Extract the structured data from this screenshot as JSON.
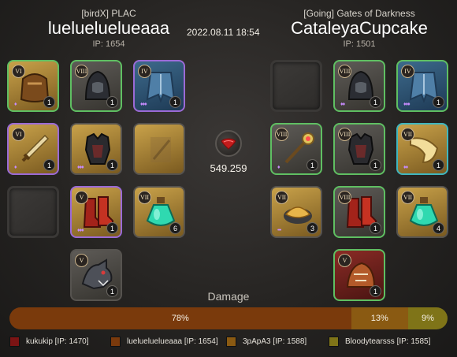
{
  "killer": {
    "guild": "[birdX] PLAC",
    "name": "luelueluelueaaa",
    "ip": "IP: 1654"
  },
  "victim": {
    "guild": "[Going] Gates of Darkness",
    "name": "CataleyaCupcake",
    "ip": "IP: 1501"
  },
  "timestamp": "2022.08.11 18:54",
  "kill_fame": "549.259",
  "colors": {
    "gold": "#c9a24a",
    "red": "#8a2b25",
    "green": "#5fbf62",
    "purple": "#9b6ad6",
    "teal": "#3fb6bf"
  },
  "killer_slots": [
    {
      "key": "bag",
      "icon": "bag-icon",
      "tier": "VI",
      "qty": "1",
      "frame": "green",
      "bg": "gold",
      "enchant": "♦"
    },
    {
      "key": "head",
      "icon": "hood-helmet-icon",
      "tier": "VIII",
      "qty": "1",
      "frame": "green",
      "bg": "gray",
      "enchant": ""
    },
    {
      "key": "cape",
      "icon": "cape-icon",
      "tier": "IV",
      "qty": "1",
      "frame": "purple",
      "bg": "blue",
      "enchant": "♦♦♦"
    },
    {
      "key": "mainhand",
      "icon": "sword-icon",
      "tier": "VI",
      "qty": "1",
      "frame": "purple",
      "bg": "gold",
      "enchant": "♦"
    },
    {
      "key": "armor",
      "icon": "armor-icon",
      "tier": "",
      "qty": "1",
      "frame": "gray",
      "bg": "gold",
      "enchant": "♦♦♦"
    },
    {
      "key": "offhand",
      "icon": "ghost-offhand-icon",
      "tier": "",
      "qty": "",
      "frame": "gray",
      "bg": "gold",
      "enchant": ""
    },
    {
      "key": "food",
      "icon": "",
      "tier": "",
      "qty": "",
      "frame": "empty",
      "bg": "",
      "enchant": ""
    },
    {
      "key": "shoes",
      "icon": "boots-icon",
      "tier": "V",
      "qty": "1",
      "frame": "purple",
      "bg": "gold",
      "enchant": "♦♦♦"
    },
    {
      "key": "potion",
      "icon": "potion-icon",
      "tier": "VII",
      "qty": "6",
      "frame": "gray",
      "bg": "gold",
      "enchant": ""
    },
    {
      "key": "mount",
      "icon": "wolf-mount-icon",
      "tier": "V",
      "qty": "1",
      "frame": "gray",
      "bg": "gray",
      "enchant": ""
    }
  ],
  "victim_slots": [
    {
      "key": "bag",
      "icon": "",
      "tier": "",
      "qty": "",
      "frame": "empty",
      "bg": "",
      "enchant": ""
    },
    {
      "key": "head",
      "icon": "hood-helmet-icon",
      "tier": "VIII",
      "qty": "1",
      "frame": "green",
      "bg": "gray",
      "enchant": "♦♦"
    },
    {
      "key": "cape",
      "icon": "cape-icon",
      "tier": "IV",
      "qty": "1",
      "frame": "green",
      "bg": "blue",
      "enchant": "♦♦♦"
    },
    {
      "key": "mainhand",
      "icon": "staff-icon",
      "tier": "VIII",
      "qty": "1",
      "frame": "green",
      "bg": "gray",
      "enchant": "♦"
    },
    {
      "key": "armor",
      "icon": "armor-icon",
      "tier": "VIII",
      "qty": "1",
      "frame": "green",
      "bg": "gray",
      "enchant": ""
    },
    {
      "key": "offhand",
      "icon": "horn-offhand-icon",
      "tier": "VII",
      "qty": "1",
      "frame": "teal",
      "bg": "gold",
      "enchant": "♦♦"
    },
    {
      "key": "food",
      "icon": "omelette-icon",
      "tier": "VII",
      "qty": "3",
      "frame": "gray",
      "bg": "gold",
      "enchant": "•••"
    },
    {
      "key": "shoes",
      "icon": "boots-icon",
      "tier": "VIII",
      "qty": "1",
      "frame": "green",
      "bg": "gray",
      "enchant": ""
    },
    {
      "key": "potion",
      "icon": "potion-icon",
      "tier": "VII",
      "qty": "4",
      "frame": "gray",
      "bg": "gold",
      "enchant": ""
    },
    {
      "key": "mount",
      "icon": "saddle-mount-icon",
      "tier": "V",
      "qty": "1",
      "frame": "green",
      "bg": "red",
      "enchant": ""
    }
  ],
  "damage": {
    "label": "Damage",
    "segments": [
      {
        "label": "78%",
        "value": 78,
        "color": "#7a3a0c"
      },
      {
        "label": "13%",
        "value": 13,
        "color": "#8a5a12"
      },
      {
        "label": "9%",
        "value": 9,
        "color": "#7f7418"
      }
    ],
    "legend": [
      {
        "label": "kukukip [IP: 1470]",
        "color": "#7b1414"
      },
      {
        "label": "luelueluelueaaa [IP: 1654]",
        "color": "#7a3a0c"
      },
      {
        "label": "3pApA3 [IP: 1588]",
        "color": "#8a5a12"
      },
      {
        "label": "Bloodytearsss [IP: 1585]",
        "color": "#7f7418"
      }
    ]
  }
}
